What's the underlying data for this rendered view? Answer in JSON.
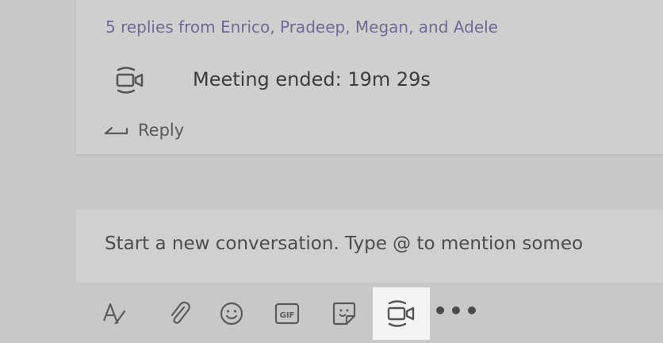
{
  "thread": {
    "replies_summary": "5 replies from Enrico, Pradeep, Megan, and Adele",
    "meeting_icon": "video-camera-icon",
    "meeting_status": "Meeting ended: 19m 29s",
    "reply_icon": "reply-arrow-icon",
    "reply_label": "Reply"
  },
  "compose": {
    "placeholder": "Start a new conversation. Type @ to mention someo"
  },
  "toolbar": {
    "items": [
      {
        "name": "format-icon",
        "interactable": true
      },
      {
        "name": "attach-icon",
        "interactable": true
      },
      {
        "name": "emoji-icon",
        "interactable": true
      },
      {
        "name": "gif-icon",
        "label": "GIF",
        "interactable": true
      },
      {
        "name": "sticker-icon",
        "interactable": true
      },
      {
        "name": "meet-now-icon",
        "interactable": true,
        "active": true
      },
      {
        "name": "more-options-icon",
        "label": "•••",
        "interactable": true
      }
    ]
  },
  "colors": {
    "background": "#c8c8c8",
    "card": "#cfcfcf",
    "link": "#6e6a97",
    "text": "#3c3c3c",
    "active_tool_bg": "#f3f3f3"
  }
}
